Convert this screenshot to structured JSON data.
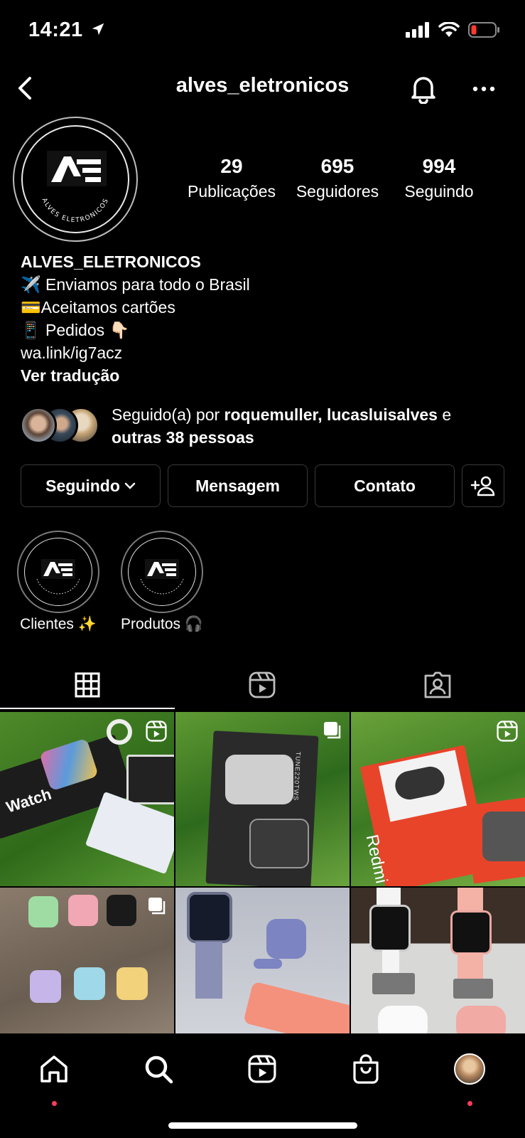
{
  "status_bar": {
    "time": "14:21"
  },
  "header": {
    "username": "alves_eletronicos"
  },
  "profile": {
    "logo_text": "ALVES ELETRONICOS",
    "stats": [
      {
        "value": "29",
        "label": "Publicações"
      },
      {
        "value": "695",
        "label": "Seguidores"
      },
      {
        "value": "994",
        "label": "Seguindo"
      }
    ],
    "bio": {
      "name": "ALVES_ELETRONICOS",
      "lines": [
        "✈️ Enviamos para todo o Brasil",
        "💳Aceitamos cartões",
        "📱 Pedidos 👇🏻"
      ],
      "link": "wa.link/ig7acz",
      "translate": "Ver tradução"
    },
    "followed_by": {
      "prefix": "Seguido(a) por ",
      "names": "roquemuller, lucasluisalves",
      "middle": " e ",
      "others": "outras 38 pessoas"
    }
  },
  "actions": {
    "following": "Seguindo",
    "message": "Mensagem",
    "contact": "Contato"
  },
  "highlights": [
    {
      "label": "Clientes ✨"
    },
    {
      "label": "Produtos 🎧"
    }
  ],
  "posts": [
    {
      "kind": "reel",
      "text": "Watch"
    },
    {
      "kind": "carousel",
      "text": "TUNE220TWS"
    },
    {
      "kind": "reel",
      "text": "Redmi"
    },
    {
      "kind": "carousel",
      "text": ""
    },
    {
      "kind": "photo",
      "text": ""
    },
    {
      "kind": "photo",
      "text": ""
    }
  ],
  "colors": {
    "background": "#000000",
    "notification_dot": "#ff3b5c",
    "battery_low": "#ff3b30"
  }
}
